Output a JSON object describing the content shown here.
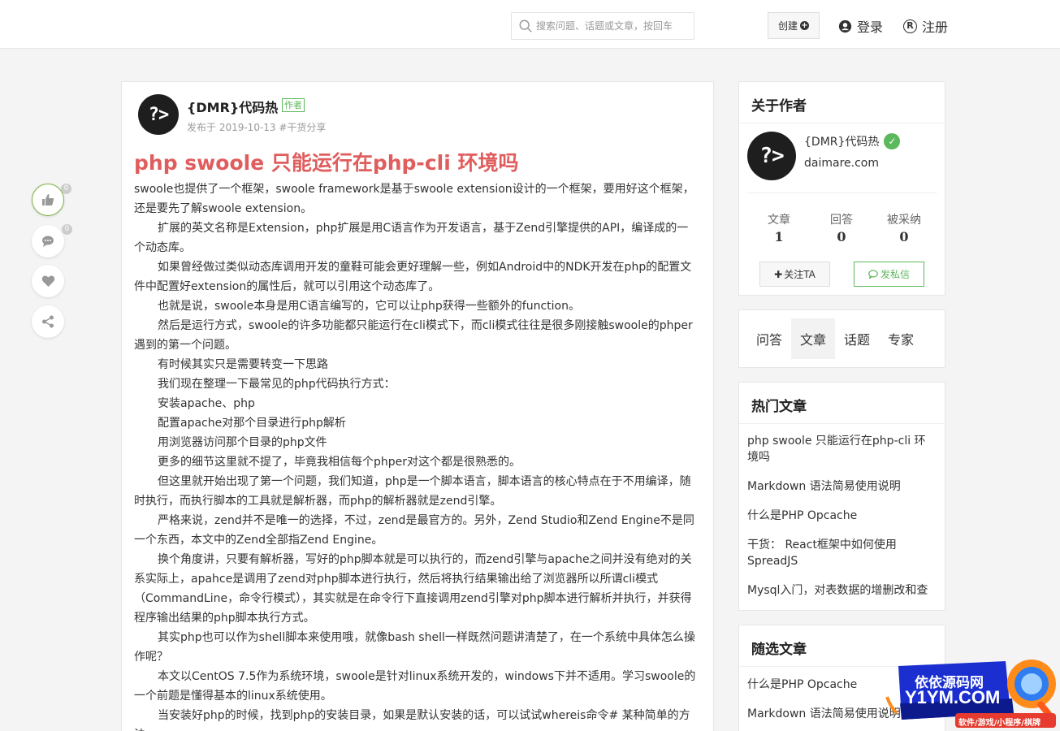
{
  "header": {
    "search_placeholder": "搜索问题、话题或文章，按回车",
    "create_label": "创建",
    "login_label": "登录",
    "register_label": "注册"
  },
  "actions": {
    "like_count": "0",
    "comment_count": "0"
  },
  "article": {
    "author_name": "{DMR}代码热",
    "author_tag": "作者",
    "meta": "发布于 2019-10-13 #干货分享",
    "title": "php swoole 只能运行在php-cli 环境吗",
    "paragraphs": [
      {
        "text": "swoole也提供了一个框架，swoole framework是基于swoole extension设计的一个框架，要用好这个框架，还是要先了解swoole extension。",
        "indent": false
      },
      {
        "text": "扩展的英文名称是Extension，php扩展是用C语言作为开发语言，基于Zend引擎提供的API，编译成的一个动态库。",
        "indent": true
      },
      {
        "text": "如果曾经做过类似动态库调用开发的童鞋可能会更好理解一些，例如Android中的NDK开发在php的配置文件中配置好extension的属性后，就可以引用这个动态库了。",
        "indent": true
      },
      {
        "text": "也就是说，swoole本身是用C语言编写的，它可以让php获得一些额外的function。",
        "indent": true
      },
      {
        "text": "然后是运行方式，swoole的许多功能都只能运行在cli模式下，而cli模式往往是很多刚接触swoole的phper遇到的第一个问题。",
        "indent": true
      },
      {
        "text": "有时候其实只是需要转变一下思路",
        "indent": true
      },
      {
        "text": "我们现在整理一下最常见的php代码执行方式：",
        "indent": true
      },
      {
        "text": "安装apache、php",
        "indent": true
      },
      {
        "text": "配置apache对那个目录进行php解析",
        "indent": true
      },
      {
        "text": "用浏览器访问那个目录的php文件",
        "indent": true
      },
      {
        "text": "更多的细节这里就不提了，毕竟我相信每个phper对这个都是很熟悉的。",
        "indent": true
      },
      {
        "text": "但这里就开始出现了第一个问题，我们知道，php是一个脚本语言，脚本语言的核心特点在于不用编译，随时执行，而执行脚本的工具就是解析器，而php的解析器就是zend引擎。",
        "indent": true
      },
      {
        "text": "严格来说，zend并不是唯一的选择，不过，zend是最官方的。另外，Zend Studio和Zend Engine不是同一个东西，本文中的Zend全部指Zend Engine。",
        "indent": true
      },
      {
        "text": "换个角度讲，只要有解析器，写好的php脚本就是可以执行的，而zend引擎与apache之间并没有绝对的关系实际上，apahce是调用了zend对php脚本进行执行，然后将执行结果输出给了浏览器所以所谓cli模式（CommandLine，命令行模式），其实就是在命令行下直接调用zend引擎对php脚本进行解析并执行，并获得程序输出结果的php脚本执行方式。",
        "indent": true
      },
      {
        "text": "其实php也可以作为shell脚本来使用哦，就像bash shell一样既然问题讲清楚了，在一个系统中具体怎么操作呢？",
        "indent": true
      },
      {
        "text": "本文以CentOS 7.5作为系统环境，swoole是针对linux系统开发的，windows下并不适用。学习swoole的一个前题是懂得基本的linux系统使用。",
        "indent": true
      },
      {
        "text": "当安装好php的时候，找到php的安装目录，如果是默认安装的话，可以试试whereis命令# 某种简单的方法",
        "indent": true
      }
    ]
  },
  "sidebar": {
    "about_title": "关于作者",
    "author_name": "{DMR}代码热",
    "author_site": "daimare.com",
    "stats": [
      {
        "label": "文章",
        "value": "1"
      },
      {
        "label": "回答",
        "value": "0"
      },
      {
        "label": "被采纳",
        "value": "0"
      }
    ],
    "follow_label": "关注TA",
    "message_label": "发私信",
    "tabs": [
      "问答",
      "文章",
      "话题",
      "专家"
    ],
    "hot_title": "热门文章",
    "hot_items": [
      "php swoole 只能运行在php-cli 环境吗",
      "Markdown 语法简易使用说明",
      "什么是PHP Opcache",
      "干货： React框架中如何使用SpreadJS",
      "Mysql入门，对表数据的增删改和查"
    ],
    "random_title": "随选文章",
    "random_items": [
      "什么是PHP Opcache",
      "Markdown 语法简易使用说明"
    ]
  },
  "watermark": {
    "line1": "依依源码网",
    "line2": "Y1YM.COM",
    "line3": "软件/游戏/小程序/棋牌"
  }
}
